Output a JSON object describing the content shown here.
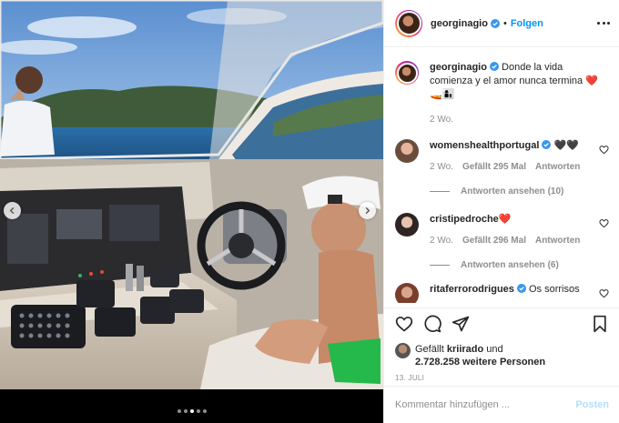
{
  "post": {
    "username": "georginagio",
    "follow_label": "Folgen",
    "separator": "•",
    "caption": "Donde la vida comienza y el amor nunca termina ❤️🚤👩‍👦",
    "caption_time": "2 Wo.",
    "image_dots": {
      "count": 5,
      "active": 2
    }
  },
  "comments": [
    {
      "username": "womenshealthportugal",
      "text": "🖤🖤",
      "time": "2 Wo.",
      "likes": "Gefällt 295 Mal",
      "reply_label": "Antworten",
      "view_replies": "Antworten ansehen (10)"
    },
    {
      "username": "cristipedroche",
      "text": "❤️",
      "time": "2 Wo.",
      "likes": "Gefällt 296 Mal",
      "reply_label": "Antworten",
      "view_replies": "Antworten ansehen (6)"
    },
    {
      "username": "ritaferrorodrigues",
      "text": "Os sorrisos"
    }
  ],
  "likes": {
    "prefix": "Gefällt",
    "user": "kriirado",
    "joiner": "und",
    "count": "2.728.258",
    "suffix": "weitere Personen"
  },
  "date": "13. Juli",
  "comment_box": {
    "placeholder": "Kommentar hinzufügen ...",
    "post_label": "Posten"
  },
  "colors": {
    "accent": "#0095f6",
    "post_disabled": "#b2dffc",
    "verified": "#3897f0"
  },
  "icons": [
    "chevron-left-icon",
    "chevron-right-icon",
    "more-icon",
    "verified-icon",
    "heart-icon",
    "comment-icon",
    "share-icon",
    "bookmark-icon"
  ]
}
